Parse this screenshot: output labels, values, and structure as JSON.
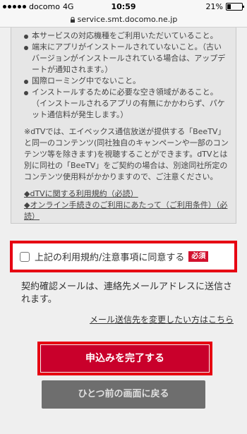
{
  "status_bar": {
    "carrier": "docomo",
    "network": "4G",
    "time": "10:59",
    "battery": "21%"
  },
  "url_bar": {
    "url": "service.smt.docomo.ne.jp"
  },
  "terms": {
    "bullets": [
      "本サービスの対応機種をご利用いただいていること。",
      "端末にアプリがインストールされていないこと。（古いバージョンがインストールされている場合は、アップデートが通知されます。）",
      "国際ローミング中でないこと。",
      "インストールするために必要な空き領域があること。（インストールされるアプリの有無にかかわらず、パケット通信料が発生します。）"
    ],
    "note": "※dTVでは、エイベックス通信放送が提供する「BeeTV」と同一のコンテンツ(同社独自のキャンペーンや一部のコンテンツ等を除きます)を視聴することができます。dTVとは別に同社の「BeeTV」をご契約の場合は、別途同社所定のコンテンツ使用料がかかりますので、ご注意ください。",
    "link_terms": "◆dTVに関する利用規約（必読）",
    "link_online": "◆オンライン手続きのご利用にあたって（ご利用条件）（必読）"
  },
  "agree": {
    "label": "上記の利用規約/注意事項に同意する",
    "required_badge": "必須"
  },
  "notice": "契約確認メールは、連絡先メールアドレスに送信されます。",
  "change_email_link": "メール送信先を変更したい方はこちら",
  "buttons": {
    "submit": "申込みを完了する",
    "back": "ひとつ前の画面に戻る"
  },
  "colors": {
    "highlight_border": "#e60012",
    "submit_bg": "#c9002b",
    "back_bg": "#6e6e6e",
    "badge_bg": "#d2112e"
  }
}
